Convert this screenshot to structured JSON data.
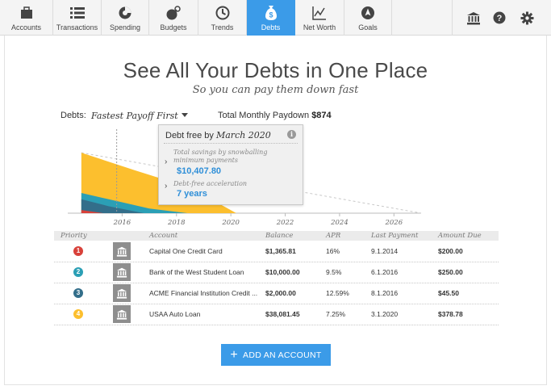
{
  "nav": {
    "tabs": [
      {
        "label": "Accounts",
        "icon": "accounts-icon"
      },
      {
        "label": "Transactions",
        "icon": "transactions-icon"
      },
      {
        "label": "Spending",
        "icon": "spending-icon"
      },
      {
        "label": "Budgets",
        "icon": "budgets-icon"
      },
      {
        "label": "Trends",
        "icon": "trends-icon"
      },
      {
        "label": "Debts",
        "icon": "debts-icon",
        "active": true
      },
      {
        "label": "Net Worth",
        "icon": "net-worth-icon"
      },
      {
        "label": "Goals",
        "icon": "goals-icon"
      }
    ],
    "utilities": [
      "bank-icon",
      "help-icon",
      "gear-icon"
    ]
  },
  "hero": {
    "title": "See All Your Debts in One Place",
    "subtitle": "So you can pay them down fast"
  },
  "controls": {
    "debts_label": "Debts:",
    "sort_value": "Fastest Payoff First",
    "paydown_label": "Total Monthly Paydown",
    "paydown_value": "$874"
  },
  "tooltip": {
    "head_prefix": "Debt free by",
    "head_date": "March 2020",
    "savings_note": "Total savings by snowballing minimum payments",
    "savings_value": "$10,407.80",
    "acceleration_note": "Debt-free acceleration",
    "acceleration_value": "7 years"
  },
  "chart_data": {
    "type": "area",
    "x_tick_labels": [
      "2016",
      "2018",
      "2020",
      "2022",
      "2024",
      "2026"
    ],
    "x_tick_years": [
      2016,
      2018,
      2020,
      2022,
      2024,
      2026
    ],
    "xlim": [
      2014,
      2027
    ],
    "series": [
      {
        "color": "#fcbf2e",
        "x": [
          2014.5,
          2016.5,
          2018.5,
          2020.2
        ],
        "values": [
          0.78,
          0.55,
          0.33,
          0.0
        ]
      },
      {
        "color": "#2b9fb5",
        "x": [
          2014.5,
          2016,
          2017,
          2018.4
        ],
        "values": [
          0.26,
          0.14,
          0.06,
          0.0
        ]
      },
      {
        "color": "#336e8a",
        "x": [
          2014.5,
          2015.5,
          2016.8
        ],
        "values": [
          0.18,
          0.09,
          0.0
        ]
      },
      {
        "color": "#d8413a",
        "x": [
          2014.5,
          2015.3
        ],
        "values": [
          0.04,
          0.0
        ]
      }
    ],
    "minimum_payment_line": {
      "x": [
        2014.5,
        2027
      ],
      "values": [
        0.78,
        0.0
      ]
    },
    "today_marker": 2015.8
  },
  "table": {
    "headers": [
      "Priority",
      "Account",
      "Balance",
      "APR",
      "Last Payment",
      "Amount Due"
    ],
    "rows": [
      {
        "priority": "1",
        "color": "#d8413a",
        "account": "Capital One Credit Card",
        "balance": "$1,365.81",
        "apr": "16%",
        "last_payment": "9.1.2014",
        "amount_due": "$200.00"
      },
      {
        "priority": "2",
        "color": "#2b9fb5",
        "account": "Bank of the West Student Loan",
        "balance": "$10,000.00",
        "apr": "9.5%",
        "last_payment": "6.1.2016",
        "amount_due": "$250.00"
      },
      {
        "priority": "3",
        "color": "#336e8a",
        "account": "ACME Financial Institution Credit ...",
        "balance": "$2,000.00",
        "apr": "12.59%",
        "last_payment": "8.1.2016",
        "amount_due": "$45.50"
      },
      {
        "priority": "4",
        "color": "#fcbf2e",
        "account": "USAA Auto Loan",
        "balance": "$38,081.45",
        "apr": "7.25%",
        "last_payment": "3.1.2020",
        "amount_due": "$378.78"
      }
    ]
  },
  "add_button": {
    "label": "ADD AN ACCOUNT"
  }
}
